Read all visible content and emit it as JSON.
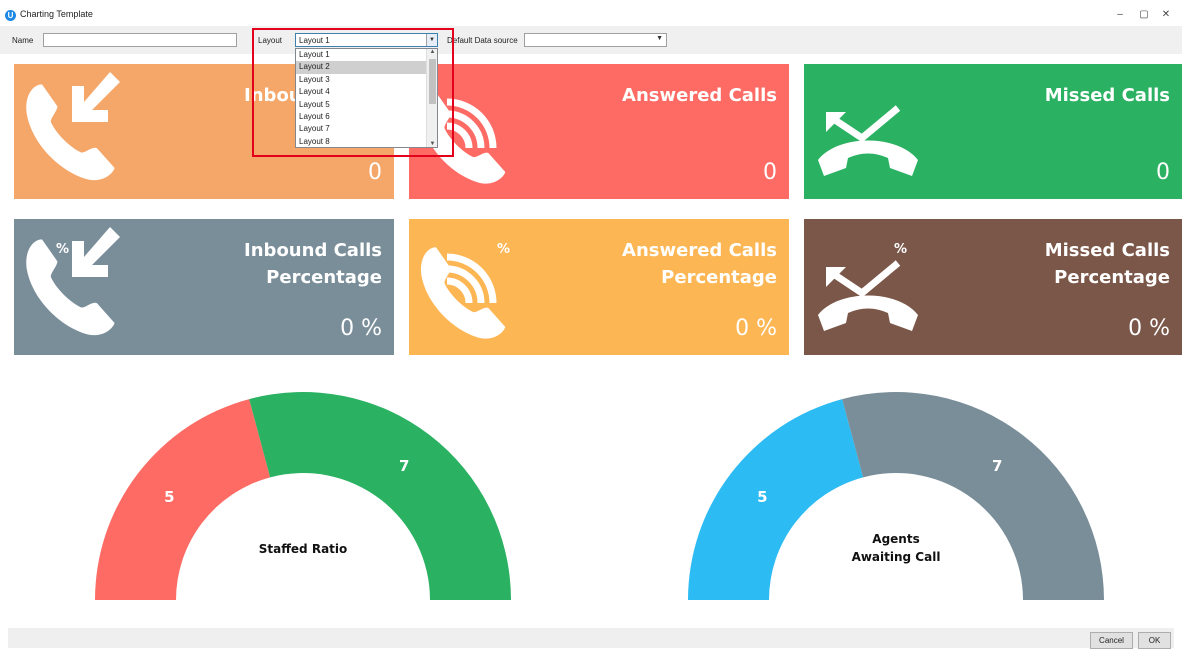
{
  "window": {
    "title": "Charting Template",
    "app_icon_glyph": "U",
    "minimize_glyph": "–",
    "restore_glyph": "▢",
    "close_glyph": "✕"
  },
  "toolbar": {
    "name_label": "Name",
    "name_value": "",
    "layout_label": "Layout",
    "layout_value": "Layout 1",
    "datasource_label": "Default Data source",
    "datasource_value": ""
  },
  "layout_dropdown": {
    "options": [
      "Layout 1",
      "Layout 2",
      "Layout 3",
      "Layout 4",
      "Layout 5",
      "Layout 6",
      "Layout 7",
      "Layout 8"
    ],
    "highlighted": "Layout 2"
  },
  "tiles": [
    {
      "title_line1": "Inbound Calls",
      "title_line2": "",
      "value": "0",
      "color": "#f5a76a",
      "icon": "phone-incoming-icon"
    },
    {
      "title_line1": "Answered Calls",
      "title_line2": "",
      "value": "0",
      "color": "#fe6b64",
      "icon": "phone-ringing-icon"
    },
    {
      "title_line1": "Missed Calls",
      "title_line2": "",
      "value": "0",
      "color": "#2ab162",
      "icon": "missed-call-icon"
    },
    {
      "title_line1": "Inbound Calls",
      "title_line2": "Percentage",
      "value": "0 %",
      "color": "#7a8e9a",
      "icon": "phone-incoming-percent-icon"
    },
    {
      "title_line1": "Answered Calls",
      "title_line2": "Percentage",
      "value": "0 %",
      "color": "#fdb654",
      "icon": "phone-ringing-percent-icon"
    },
    {
      "title_line1": "Missed Calls",
      "title_line2": "Percentage",
      "value": "0 %",
      "color": "#7b5749",
      "icon": "missed-call-percent-icon"
    }
  ],
  "gauges": [
    {
      "label_line1": "Staffed Ratio",
      "label_line2": "",
      "left_value": "5",
      "right_value": "7",
      "left_color": "#fe6b64",
      "right_color": "#2ab162"
    },
    {
      "label_line1": "Agents",
      "label_line2": "Awaiting Call",
      "left_value": "5",
      "right_value": "7",
      "left_color": "#2dbbf3",
      "right_color": "#7a8e9a"
    }
  ],
  "icon_percent_glyph": "%",
  "footer": {
    "cancel_label": "Cancel",
    "ok_label": "OK"
  }
}
